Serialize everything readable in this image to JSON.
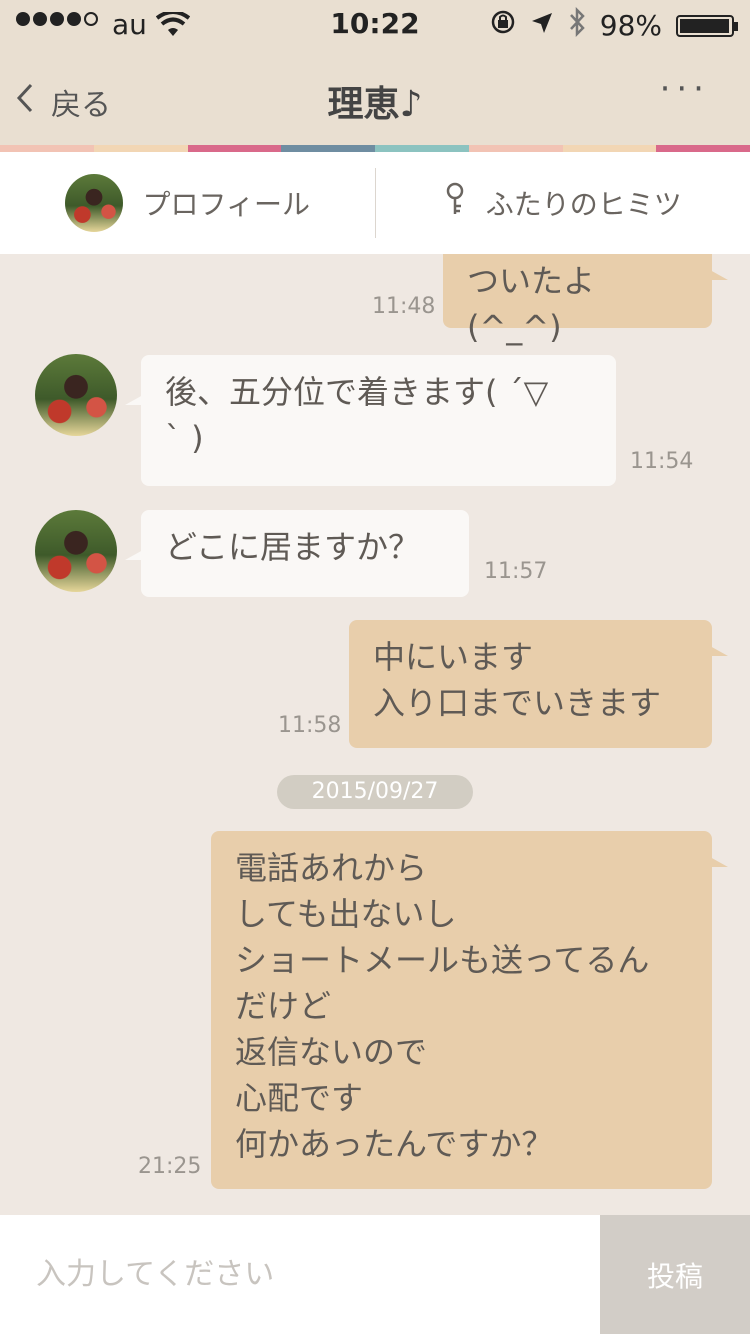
{
  "status_bar": {
    "carrier": "au",
    "time": "10:22",
    "battery_text": "98%",
    "battery_level": 0.98,
    "signal_bars": 4
  },
  "nav": {
    "back_label": "戻る",
    "title": "理恵♪",
    "more_label": "···"
  },
  "stripe_colors": [
    "#f2c3b4",
    "#f2d6b4",
    "#d9698a",
    "#6f8da1",
    "#8cc3c0",
    "#f2c3b4",
    "#f2d6b4",
    "#d9698a"
  ],
  "tabs": {
    "profile": "プロフィール",
    "secret": "ふたりのヒミツ"
  },
  "messages": [
    {
      "side": "out",
      "text": "ついたよ(^_^)",
      "time": "11:48"
    },
    {
      "side": "in",
      "text": "後、五分位で着きます( ´▽\n` )",
      "time": "11:54"
    },
    {
      "side": "in",
      "text": "どこに居ますか？",
      "time": "11:57"
    },
    {
      "side": "out",
      "text": "中にいます\n入り口までいきます",
      "time": "11:58"
    },
    {
      "side": "out",
      "text": "電話あれから\nしても出ないし\nショートメールも送ってるん\nだけど\n返信ないので\n心配です\n何かあったんですか？",
      "time": "21:25"
    }
  ],
  "date_separator": "2015/09/27",
  "input": {
    "placeholder": "入力してください",
    "value": "",
    "post_label": "投稿"
  },
  "colors": {
    "header_bg": "#e9dfd1",
    "chat_bg": "#efe8e2",
    "outgoing_bubble": "#e8ceab",
    "incoming_bubble": "#faf8f6"
  }
}
